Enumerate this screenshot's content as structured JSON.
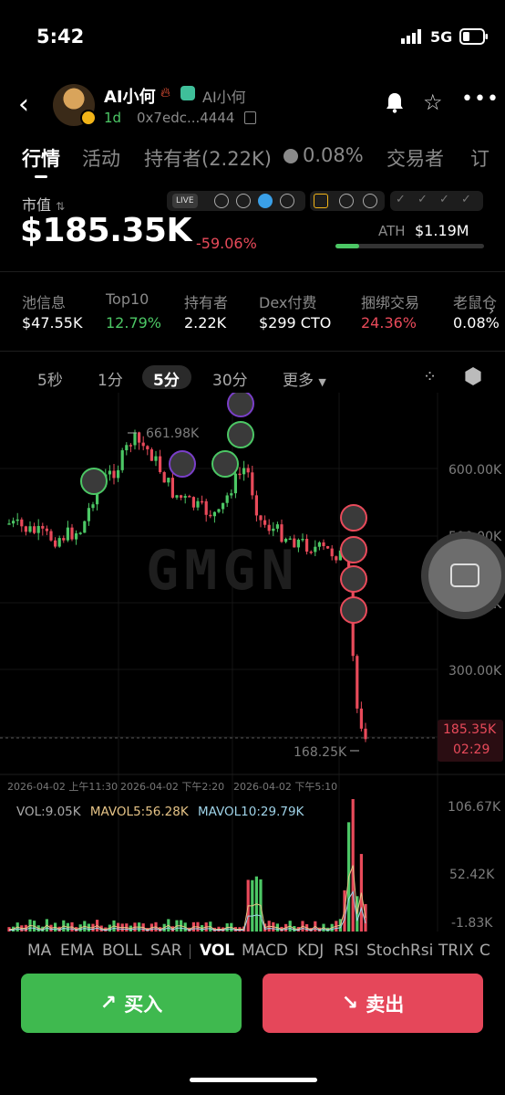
{
  "status_bar": {
    "time": "5:42",
    "network": "5G",
    "battery_level": 0.35
  },
  "header": {
    "token_name": "AI小何",
    "sub_name": "AI小何",
    "age": "1d",
    "address": "0x7edc...4444",
    "icons": [
      "back-arrow-icon",
      "fire-icon",
      "robot-icon",
      "copy-icon",
      "bell-icon",
      "star-icon",
      "more-icon"
    ]
  },
  "tabs": [
    "行情",
    "活动",
    "持有者(2.22K)",
    "0.08%",
    "交易者",
    "订"
  ],
  "market": {
    "mc_label": "市值",
    "market_cap": "$185.35K",
    "change": "-59.06%",
    "live_tag": "LIVE",
    "ath_label": "ATH",
    "ath_value": "$1.19M",
    "ath_progress": 0.16
  },
  "stats": [
    {
      "label": "池信息",
      "value": "$47.55K",
      "color": "#ffffff"
    },
    {
      "label": "Top10",
      "value": "12.79%",
      "color": "#4cc765"
    },
    {
      "label": "持有者",
      "value": "2.22K",
      "color": "#ffffff"
    },
    {
      "label": "Dex付费",
      "value": "$299 CTO",
      "color": "#ffffff"
    },
    {
      "label": "捆绑交易",
      "value": "24.36%",
      "color": "#e84a5a"
    },
    {
      "label": "老鼠仓",
      "value": "0.08%",
      "color": "#ffffff"
    }
  ],
  "intervals": [
    "5秒",
    "1分",
    "5分",
    "30分",
    "更多"
  ],
  "active_interval": "5分",
  "chart": {
    "y_labels": [
      "600.00K",
      "500.00K",
      "400.00K",
      "300.00K"
    ],
    "high_label": "661.98K",
    "low_label": "168.25K",
    "current_price": "185.35K",
    "countdown": "02:29",
    "time_labels": [
      "2026-04-02 上午11:30",
      "2026-04-02 下午2:20",
      "2026-04-02 下午5:10"
    ],
    "watermark": "GMGN"
  },
  "volume": {
    "vol": "VOL:9.05K",
    "mavol5": "MAVOL5:56.28K",
    "mavol10": "MAVOL10:29.79K",
    "axis": [
      "106.67K",
      "52.42K",
      "-1.83K"
    ]
  },
  "indicators": [
    "MA",
    "EMA",
    "BOLL",
    "SAR",
    "VOL",
    "MACD",
    "KDJ",
    "RSI",
    "StochRsi",
    "TRIX",
    "C"
  ],
  "active_indicator": "VOL",
  "buttons": {
    "buy": "买入",
    "sell": "卖出"
  },
  "colors": {
    "up": "#4cc765",
    "down": "#e84a5a",
    "buy": "#3fb94f",
    "sell": "#e5475a"
  }
}
